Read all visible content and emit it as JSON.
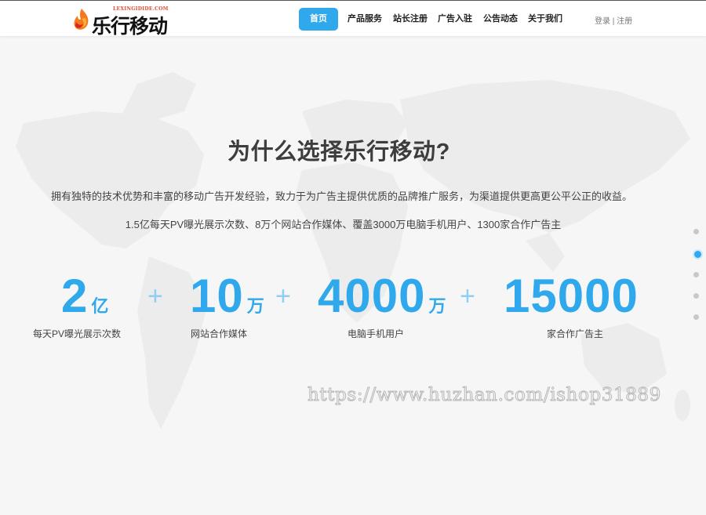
{
  "header": {
    "logo_text": "乐行移动",
    "logo_subtext": "LEXINGIDIDE.COM",
    "nav": [
      {
        "label": "首页",
        "active": true
      },
      {
        "label": "产品服务",
        "active": false
      },
      {
        "label": "站长注册",
        "active": false
      },
      {
        "label": "广告入驻",
        "active": false
      },
      {
        "label": "公告动态",
        "active": false
      },
      {
        "label": "关于我们",
        "active": false
      }
    ],
    "login": "登录",
    "separator": "|",
    "register": "注册"
  },
  "main": {
    "title": "为什么选择乐行移动?",
    "description": "拥有独特的技术优势和丰富的移动广告开发经验，致力于为广告主提供优质的品牌推广服务，为渠道提供更高更公平公正的收益。",
    "summary": "1.5亿每天PV曝光展示次数、8万个网站合作媒体、覆盖3000万电脑手机用户、1300家合作广告主",
    "stats": [
      {
        "number": "2",
        "unit": "亿",
        "label": "每天PV曝光展示次数"
      },
      {
        "number": "10",
        "unit": "万",
        "label": "网站合作媒体"
      },
      {
        "number": "4000",
        "unit": "万",
        "label": "电脑手机用户"
      },
      {
        "number": "15000",
        "unit": "",
        "label": "家合作广告主"
      }
    ],
    "plus_sign": "+"
  },
  "pagination": {
    "count": 5,
    "active_index": 1
  },
  "watermark": "https://www.huzhan.com/ishop31889",
  "colors": {
    "accent": "#2fa9ec",
    "plus": "#8fcff3",
    "title": "#3d3d3d",
    "background": "#f6f6f6"
  }
}
